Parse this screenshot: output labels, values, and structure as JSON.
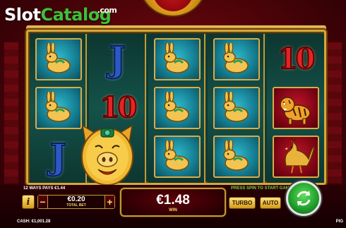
{
  "logo": {
    "part1": "Slot",
    "part2": "Catalog",
    "suffix": ".com"
  },
  "reels": [
    [
      "rabbit",
      "rabbit",
      "J"
    ],
    [
      "J",
      "10",
      "pig"
    ],
    [
      "rabbit",
      "rabbit",
      "rabbit"
    ],
    [
      "rabbit",
      "rabbit",
      "rabbit"
    ],
    [
      "10",
      "tiger",
      "rooster"
    ]
  ],
  "symbols": {
    "J": "J",
    "10": "10"
  },
  "hud": {
    "ways_text": "12 WAYS PAYS €1.44",
    "press_text": "PRESS SPIN TO START GAME",
    "bet_value": "€0.20",
    "bet_label": "TOTAL BET",
    "minus": "−",
    "plus": "+",
    "info": "i",
    "win_value": "€1.48",
    "win_label": "WIN",
    "turbo": "TURBO",
    "auto": "AUTO",
    "cash_text": "CASH:  €1,001.28",
    "corner_text": "PIG"
  },
  "colors": {
    "accent_gold": "#d7a63a",
    "spin_green": "#1e9a2a",
    "reel_bg": "#14524a",
    "press_green": "#6fd54d"
  }
}
